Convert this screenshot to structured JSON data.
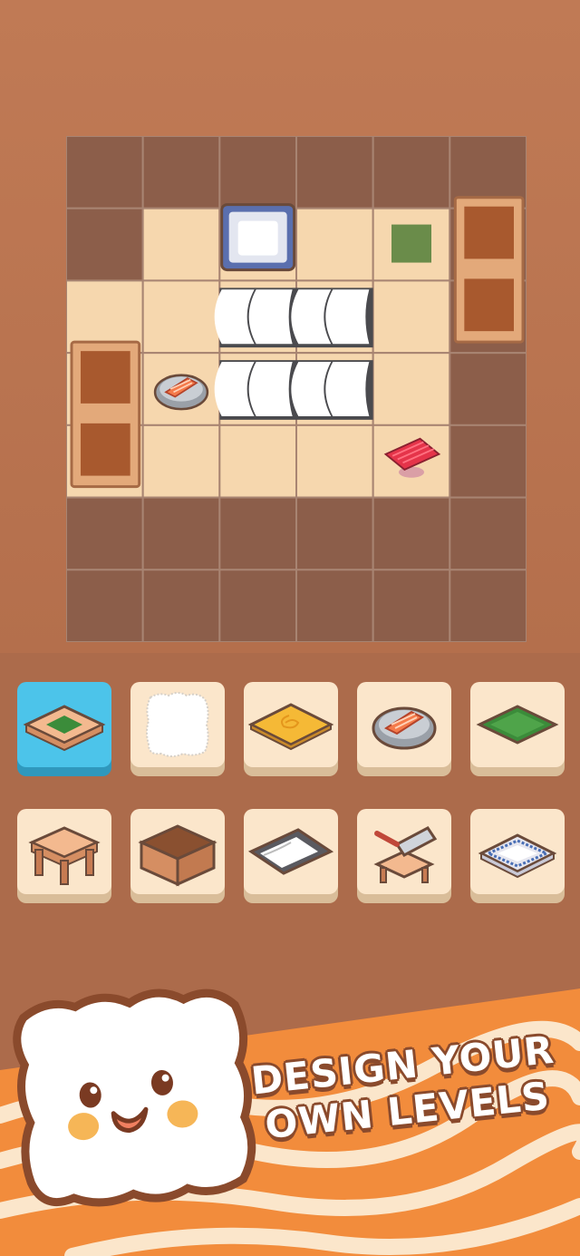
{
  "board": {
    "cols": 6,
    "rows": 7,
    "wall_color": "#8c5e4a",
    "floor_color": "#f6d7ae",
    "grid_line_color": "#a88472",
    "floor_cells": [
      [
        1,
        1
      ],
      [
        2,
        1
      ],
      [
        3,
        1
      ],
      [
        4,
        1
      ],
      [
        0,
        2
      ],
      [
        1,
        2
      ],
      [
        2,
        2
      ],
      [
        3,
        2
      ],
      [
        4,
        2
      ],
      [
        0,
        3
      ],
      [
        1,
        3
      ],
      [
        2,
        3
      ],
      [
        3,
        3
      ],
      [
        4,
        3
      ],
      [
        0,
        4
      ],
      [
        1,
        4
      ],
      [
        2,
        4
      ],
      [
        3,
        4
      ],
      [
        4,
        4
      ]
    ],
    "pieces": [
      {
        "type": "plate",
        "icon": "plate-icon",
        "col": 2,
        "row": 1
      },
      {
        "type": "seaweed",
        "icon": "seaweed-icon",
        "col": 4,
        "row": 1
      },
      {
        "type": "table",
        "icon": "table-icon",
        "col": 5,
        "row": 1,
        "span": 2
      },
      {
        "type": "table",
        "icon": "table-icon",
        "col": 0,
        "row": 3,
        "span": 2
      },
      {
        "type": "salmon-bowl",
        "icon": "salmon-bowl-icon",
        "col": 1,
        "row": 3
      },
      {
        "type": "fish-slice",
        "icon": "tuna-slice-icon",
        "col": 4,
        "row": 4
      },
      {
        "type": "rice-roller",
        "icon": "rice-roller-icon",
        "col": 2,
        "row": 2
      },
      {
        "type": "rice-roller",
        "icon": "rice-roller-icon",
        "col": 3,
        "row": 2
      },
      {
        "type": "rice-roller",
        "icon": "rice-roller-icon",
        "col": 2,
        "row": 3
      },
      {
        "type": "rice-roller",
        "icon": "rice-roller-icon",
        "col": 3,
        "row": 3
      }
    ]
  },
  "tray": {
    "selected_index": 0,
    "row1": [
      {
        "name": "floor-tile-tool",
        "icon": "floor-tile-icon"
      },
      {
        "name": "rice-tool",
        "icon": "rice-icon"
      },
      {
        "name": "egg-omelette-tool",
        "icon": "omelette-icon"
      },
      {
        "name": "salmon-bowl-tool",
        "icon": "salmon-bowl-icon"
      },
      {
        "name": "seaweed-tool",
        "icon": "seaweed-icon"
      }
    ],
    "row2": [
      {
        "name": "table-tool",
        "icon": "table-icon"
      },
      {
        "name": "wooden-box-tool",
        "icon": "wooden-box-icon"
      },
      {
        "name": "rice-roller-tool",
        "icon": "rice-roller-icon"
      },
      {
        "name": "cleaver-station-tool",
        "icon": "cleaver-icon"
      },
      {
        "name": "plate-tool",
        "icon": "plate-icon"
      }
    ]
  },
  "promo": {
    "line1": "DESIGN YOUR",
    "line2": "OWN LEVELS",
    "mascot": "rice-mascot-icon",
    "stripe_colors": [
      "#f28c3c",
      "#fbe6cb"
    ]
  }
}
